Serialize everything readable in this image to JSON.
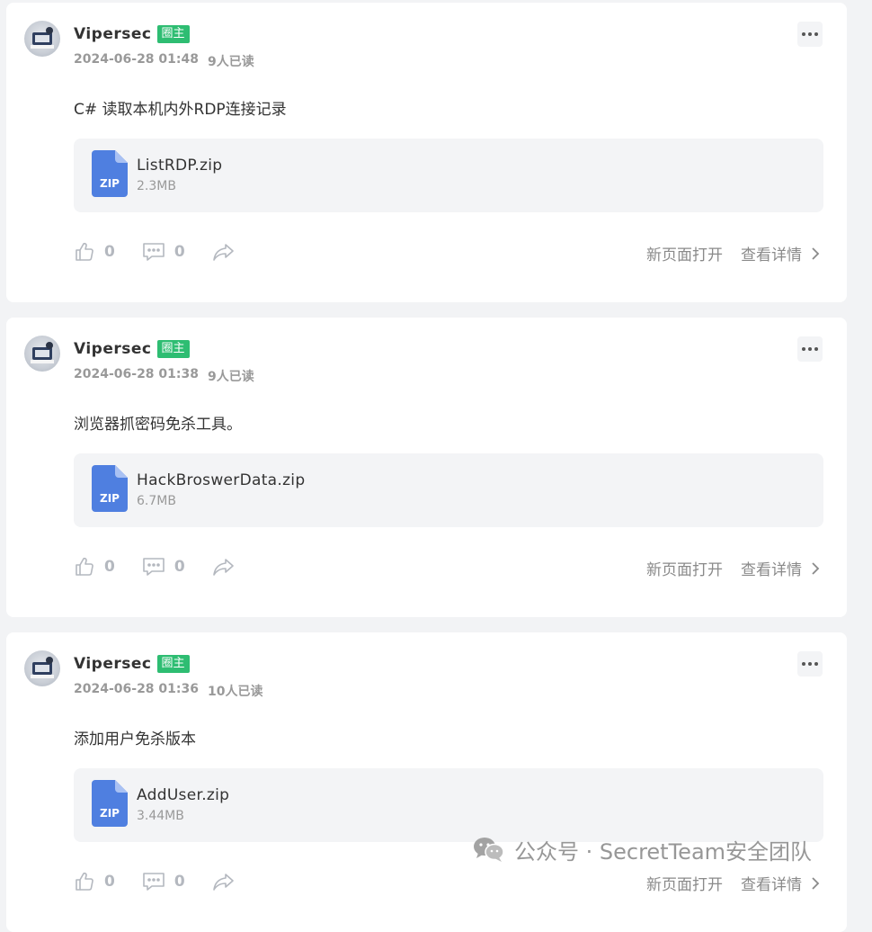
{
  "posts": [
    {
      "author": "Vipersec",
      "badge": "圈主",
      "date": "2024-06-28 01:48",
      "reads": "9人已读",
      "text": "C# 读取本机内外RDP连接记录",
      "file": {
        "name": "ListRDP.zip",
        "size": "2.3MB",
        "type": "ZIP"
      },
      "likes": "0",
      "comments": "0",
      "open_new": "新页面打开",
      "view_detail": "查看详情"
    },
    {
      "author": "Vipersec",
      "badge": "圈主",
      "date": "2024-06-28 01:38",
      "reads": "9人已读",
      "text": "浏览器抓密码免杀工具。",
      "file": {
        "name": "HackBroswerData.zip",
        "size": "6.7MB",
        "type": "ZIP"
      },
      "likes": "0",
      "comments": "0",
      "open_new": "新页面打开",
      "view_detail": "查看详情"
    },
    {
      "author": "Vipersec",
      "badge": "圈主",
      "date": "2024-06-28 01:36",
      "reads": "10人已读",
      "text": "添加用户免杀版本",
      "file": {
        "name": "AddUser.zip",
        "size": "3.44MB",
        "type": "ZIP"
      },
      "likes": "0",
      "comments": "0",
      "open_new": "新页面打开",
      "view_detail": "查看详情"
    }
  ],
  "watermark": {
    "text": "公众号 · SecretTeam安全团队",
    "icon": "wechat-icon"
  },
  "colors": {
    "badge": "#2ebd72",
    "file_icon": "#4f7fe0",
    "background": "#f2f3f5"
  }
}
